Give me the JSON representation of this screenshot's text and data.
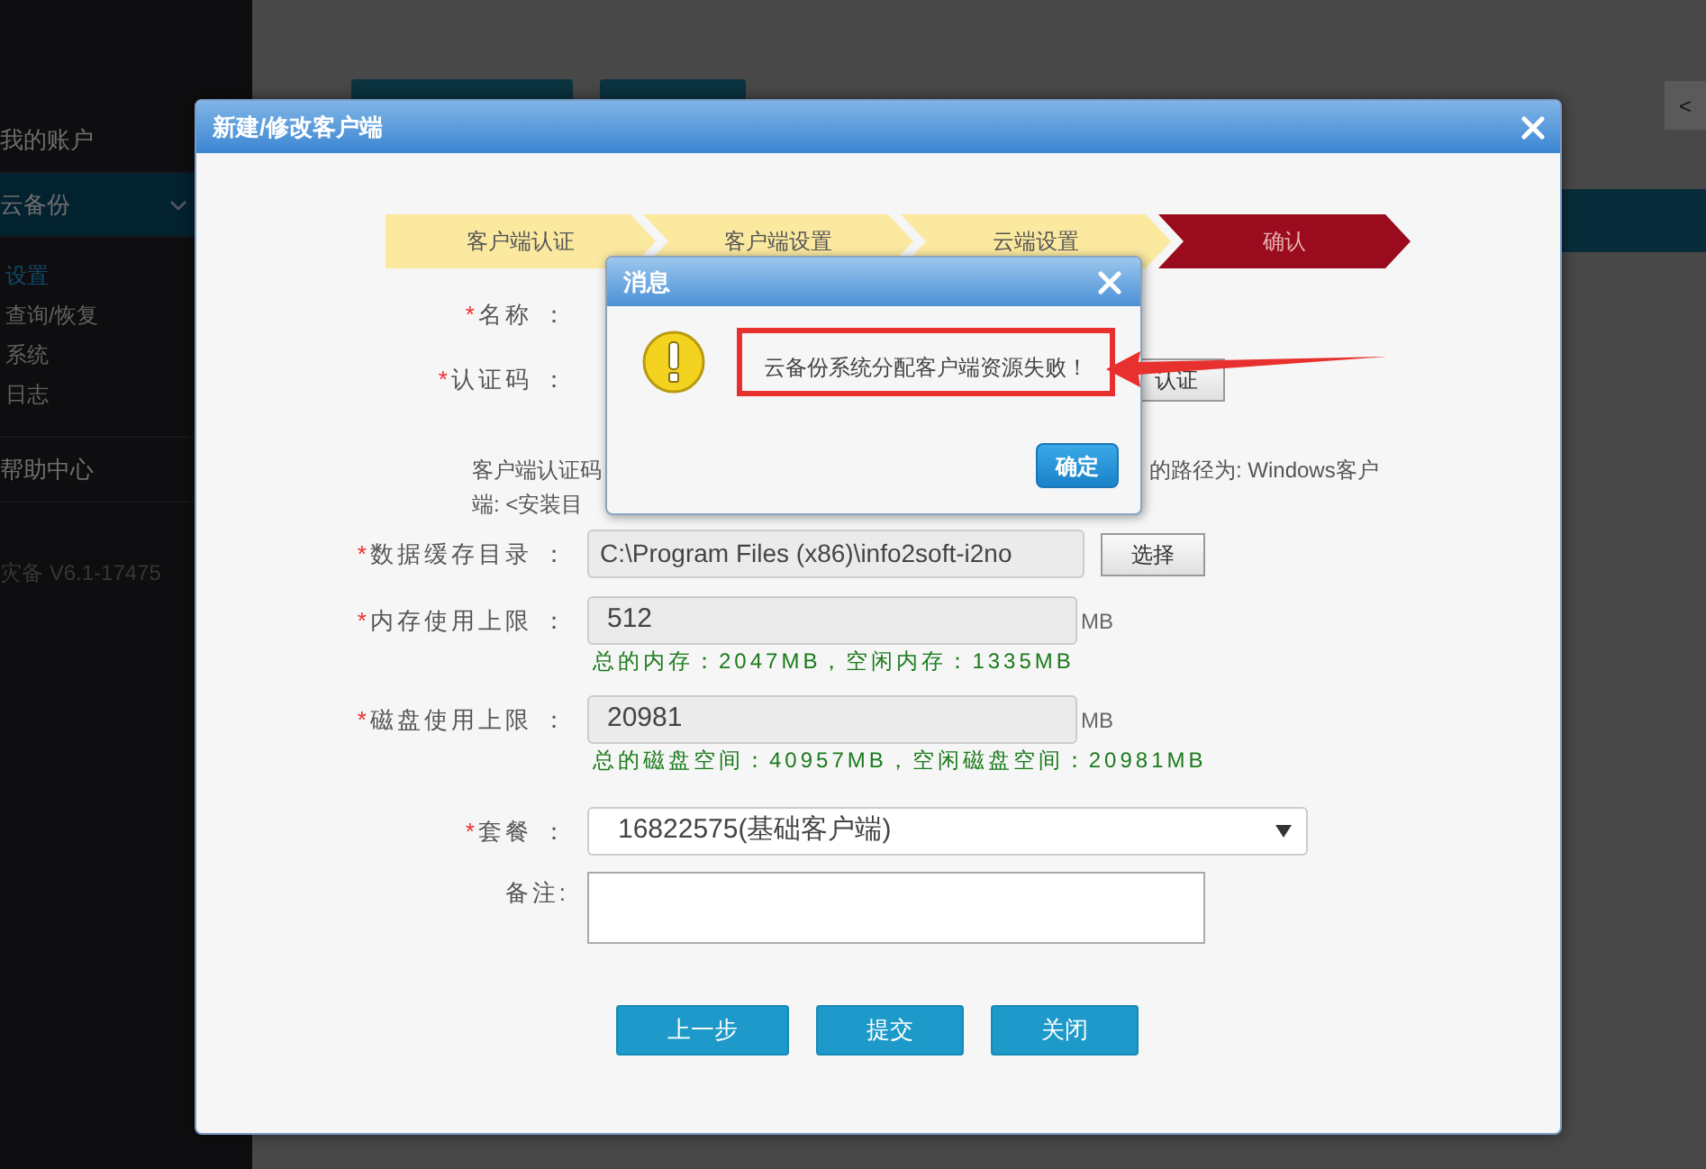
{
  "sidebar": {
    "items": [
      {
        "label": "我的账户",
        "selected": false,
        "expanded": false
      },
      {
        "label": "云备份",
        "selected": false,
        "expanded": true,
        "children": [
          {
            "label": "设置",
            "selected": true
          },
          {
            "label": "查询/恢复",
            "selected": false
          },
          {
            "label": "系统",
            "selected": false
          },
          {
            "label": "日志",
            "selected": false
          }
        ]
      },
      {
        "label": "帮助中心",
        "selected": false,
        "expanded": false
      }
    ],
    "version": "灾备  V6.1-17475"
  },
  "collapse_button": "<",
  "dialog": {
    "title": "新建/修改客户端",
    "steps": [
      {
        "label": "客户端认证",
        "selected": false
      },
      {
        "label": "客户端设置",
        "selected": false
      },
      {
        "label": "云端设置",
        "selected": false
      },
      {
        "label": "确认",
        "selected": true
      }
    ],
    "fields": [
      {
        "kind": "plain",
        "required_mark": "*",
        "label": "名称 ："
      },
      {
        "kind": "auth",
        "required_mark": "*",
        "label": "认证码 ：",
        "button": "认证"
      },
      {
        "kind": "hint",
        "fragments": [
          "客户端认证码",
          "的路径为: Windows客户",
          "端: <安装目"
        ]
      },
      {
        "kind": "path",
        "required_mark": "*",
        "label": "数据缓存目录 ：",
        "value": "C:\\Program Files (x86)\\info2soft-i2no",
        "disabled": true,
        "button": "选择"
      },
      {
        "kind": "number",
        "required_mark": "*",
        "label": "内存使用上限 ：",
        "value": "512",
        "disabled": true,
        "unit": "MB",
        "info": "总的内存：2047MB，空闲内存：1335MB"
      },
      {
        "kind": "number",
        "required_mark": "*",
        "label": "磁盘使用上限 ：",
        "value": "20981",
        "disabled": true,
        "unit": "MB",
        "info": "总的磁盘空间：40957MB，空闲磁盘空间：20981MB"
      },
      {
        "kind": "select",
        "required_mark": "*",
        "label": "套餐 ：",
        "value": "16822575(基础客户端)"
      },
      {
        "kind": "textarea",
        "label": "备注:"
      }
    ],
    "buttons": [
      "上一步",
      "提交",
      "关闭"
    ]
  },
  "message_box": {
    "title": "消息",
    "message": "云备份系统分配客户端资源失败！",
    "highlighted": true,
    "button": "确定"
  }
}
